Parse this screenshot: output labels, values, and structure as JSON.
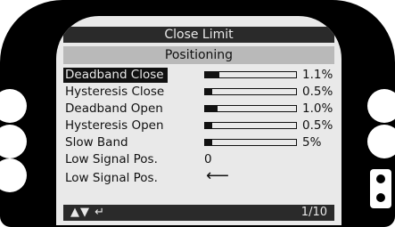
{
  "header": {
    "title": "Close Limit",
    "subtitle": "Positioning"
  },
  "rows": [
    {
      "label": "Deadband Close",
      "value": "1.1%",
      "level": 0.11,
      "selected": true
    },
    {
      "label": "Hysteresis Close",
      "value": "0.5%",
      "level": 0.05
    },
    {
      "label": "Deadband Open",
      "value": "1.0%",
      "level": 0.1
    },
    {
      "label": "Hysteresis Open",
      "value": "0.5%",
      "level": 0.05
    },
    {
      "label": "Slow Band",
      "value": "5%",
      "level": 0.05
    }
  ],
  "low_signal_pos_value": {
    "label": "Low Signal Pos.",
    "value": "0"
  },
  "low_signal_pos_enter": {
    "label": "Low Signal Pos.",
    "icon": "enter-arrow-icon"
  },
  "footer": {
    "nav_icons": "▲▼ ↵",
    "page": "1/10"
  },
  "colors": {
    "bezel": "#000000",
    "screen": "#e9e9e9",
    "selected_bar": "#b9b9b9",
    "header_bar": "#2a2a2a"
  }
}
